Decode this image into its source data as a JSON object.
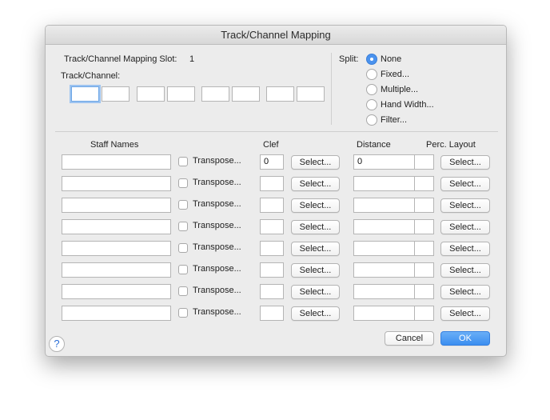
{
  "window": {
    "title": "Track/Channel Mapping"
  },
  "slot": {
    "label": "Track/Channel Mapping Slot:",
    "value": "1"
  },
  "track_channel": {
    "label": "Track/Channel:",
    "fields": [
      "",
      "",
      "",
      "",
      "",
      "",
      "",
      ""
    ]
  },
  "split": {
    "label": "Split:",
    "options": [
      {
        "label": "None",
        "selected": true
      },
      {
        "label": "Fixed...",
        "selected": false
      },
      {
        "label": "Multiple...",
        "selected": false
      },
      {
        "label": "Hand Width...",
        "selected": false
      },
      {
        "label": "Filter...",
        "selected": false
      }
    ]
  },
  "columns": {
    "staff_names": "Staff Names",
    "clef": "Clef",
    "distance": "Distance",
    "perc_layout": "Perc. Layout"
  },
  "rows": [
    {
      "staff_name": "",
      "transpose_label": "Transpose...",
      "transpose_checked": false,
      "clef": "0",
      "clef_select": "Select...",
      "distance": "0",
      "perc": "",
      "perc_select": "Select..."
    },
    {
      "staff_name": "",
      "transpose_label": "Transpose...",
      "transpose_checked": false,
      "clef": "",
      "clef_select": "Select...",
      "distance": "",
      "perc": "",
      "perc_select": "Select..."
    },
    {
      "staff_name": "",
      "transpose_label": "Transpose...",
      "transpose_checked": false,
      "clef": "",
      "clef_select": "Select...",
      "distance": "",
      "perc": "",
      "perc_select": "Select..."
    },
    {
      "staff_name": "",
      "transpose_label": "Transpose...",
      "transpose_checked": false,
      "clef": "",
      "clef_select": "Select...",
      "distance": "",
      "perc": "",
      "perc_select": "Select..."
    },
    {
      "staff_name": "",
      "transpose_label": "Transpose...",
      "transpose_checked": false,
      "clef": "",
      "clef_select": "Select...",
      "distance": "",
      "perc": "",
      "perc_select": "Select..."
    },
    {
      "staff_name": "",
      "transpose_label": "Transpose...",
      "transpose_checked": false,
      "clef": "",
      "clef_select": "Select...",
      "distance": "",
      "perc": "",
      "perc_select": "Select..."
    },
    {
      "staff_name": "",
      "transpose_label": "Transpose...",
      "transpose_checked": false,
      "clef": "",
      "clef_select": "Select...",
      "distance": "",
      "perc": "",
      "perc_select": "Select..."
    },
    {
      "staff_name": "",
      "transpose_label": "Transpose...",
      "transpose_checked": false,
      "clef": "",
      "clef_select": "Select...",
      "distance": "",
      "perc": "",
      "perc_select": "Select..."
    }
  ],
  "footer": {
    "help_label": "?",
    "cancel_label": "Cancel",
    "ok_label": "OK"
  },
  "colors": {
    "accent": "#3b8ef0",
    "dialog_bg": "#ececec"
  }
}
